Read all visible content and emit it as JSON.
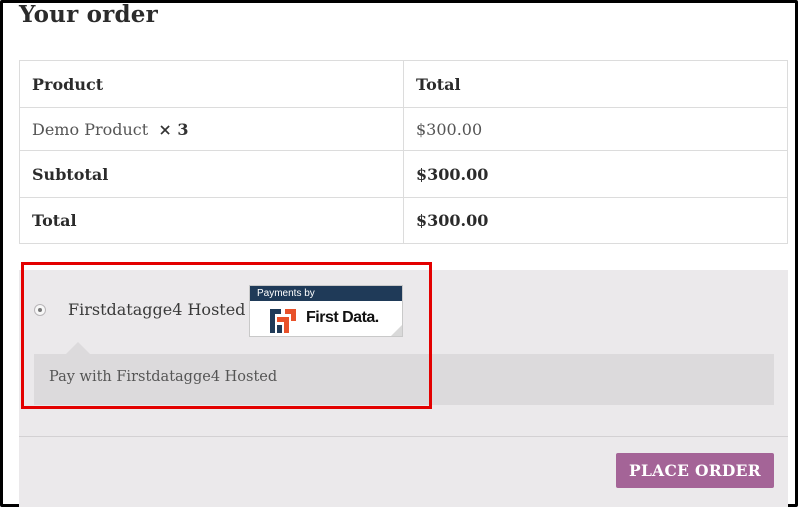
{
  "heading": "Your order",
  "table": {
    "headers": [
      "Product",
      "Total"
    ],
    "item": {
      "name": "Demo Product",
      "qty": "× 3",
      "total": "$300.00"
    },
    "subtotal": {
      "label": "Subtotal",
      "value": "$300.00"
    },
    "total": {
      "label": "Total",
      "value": "$300.00"
    }
  },
  "payment": {
    "method_label": "Firstdatagge4 Hosted",
    "selected": true,
    "badge": {
      "top_text": "Payments by",
      "brand": "First Data."
    },
    "description": "Pay with Firstdatagge4 Hosted"
  },
  "place_order_label": "PLACE ORDER",
  "colors": {
    "button": "#a46497",
    "payment_bg": "#ebe9eb",
    "highlight": "#e30000",
    "badge_header": "#1f3a58",
    "logo_orange": "#e8512a"
  }
}
